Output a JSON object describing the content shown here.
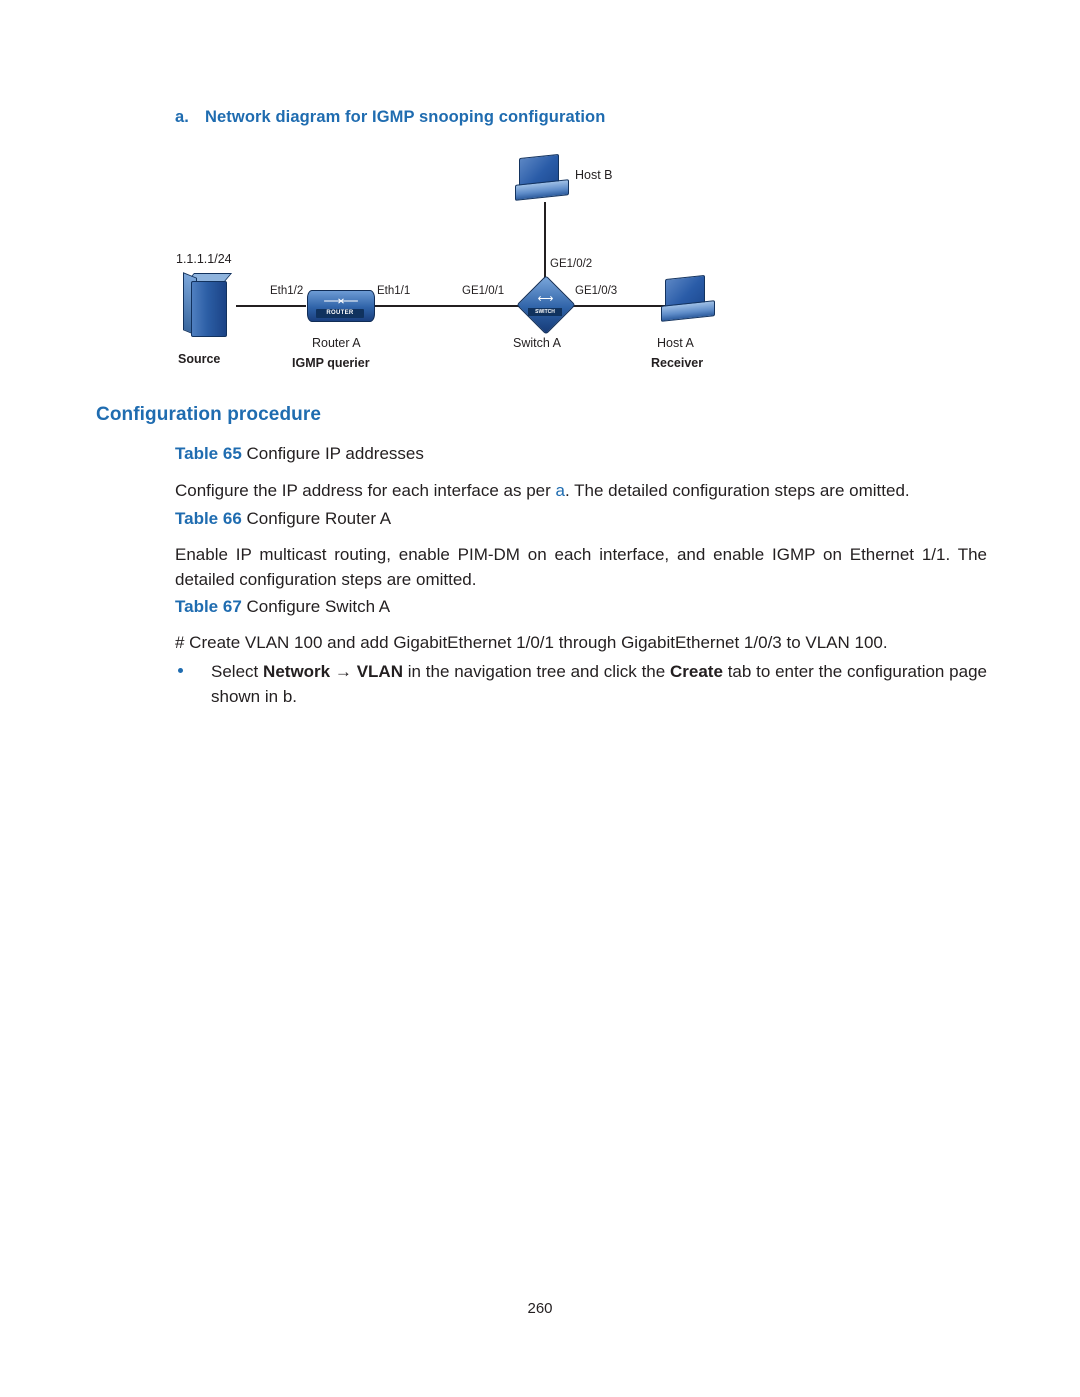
{
  "figure": {
    "label": "a.",
    "caption": "Network diagram for IGMP snooping configuration",
    "nodes": {
      "host_b": "Host B",
      "source": "Source",
      "router_a": "Router A",
      "igmp_querier": "IGMP querier",
      "switch_a": "Switch A",
      "host_a": "Host A",
      "receiver": "Receiver",
      "router_tag": "ROUTER",
      "switch_tag": "SWITCH"
    },
    "annotations": {
      "ip": "1.1.1.1/24",
      "eth1_2": "Eth1/2",
      "eth1_1": "Eth1/1",
      "ge1_0_1": "GE1/0/1",
      "ge1_0_2": "GE1/0/2",
      "ge1_0_3": "GE1/0/3"
    }
  },
  "section_title": "Configuration procedure",
  "tables": [
    {
      "label": "Table 65",
      "title": "Configure IP addresses"
    },
    {
      "label": "Table 66",
      "title": "Configure Router A"
    },
    {
      "label": "Table 67",
      "title": "Configure Switch A"
    }
  ],
  "paragraphs": {
    "p1_pre": "Configure the IP address for each interface as per ",
    "p1_xref": "a",
    "p1_post": ". The detailed configuration steps are omitted.",
    "p2": "Enable IP multicast routing, enable PIM-DM on each interface, and enable IGMP on Ethernet 1/1. The detailed configuration steps are omitted.",
    "p3": "# Create VLAN 100 and add GigabitEthernet 1/0/1 through GigabitEthernet 1/0/3 to VLAN 100.",
    "bullet_1": {
      "pre": "Select ",
      "b1": "Network",
      "arrow": " → ",
      "b2": "VLAN",
      "mid": " in the navigation tree and click the ",
      "b3": "Create",
      "post": " tab to enter the configuration page shown in ",
      "xref": "b",
      "end": "."
    }
  },
  "page_number": "260",
  "colors": {
    "accent": "#1f6cb0",
    "text": "#231f20"
  }
}
